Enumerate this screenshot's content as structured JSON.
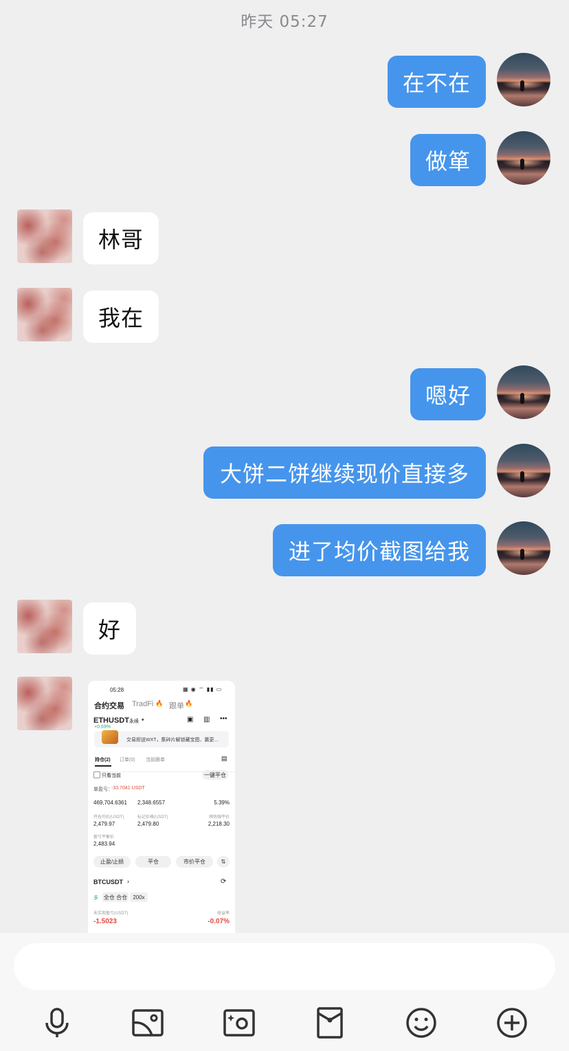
{
  "header": {
    "timestamp": "昨天 05:27"
  },
  "messages": [
    {
      "sender": "me",
      "text": "在不在"
    },
    {
      "sender": "me",
      "text": "做箪"
    },
    {
      "sender": "them",
      "text": "林哥"
    },
    {
      "sender": "them",
      "text": "我在"
    },
    {
      "sender": "me",
      "text": "嗯好"
    },
    {
      "sender": "me",
      "text": "大饼二饼继续现价直接多"
    },
    {
      "sender": "me",
      "text": "进了均价截图给我"
    },
    {
      "sender": "them",
      "text": "好"
    }
  ],
  "screenshot": {
    "status_time": "05:28",
    "tabs": [
      "合约交易",
      "TradFi",
      "跟单"
    ],
    "symbol": "ETHUSDT",
    "symbol_type": "永续",
    "change": "+0.59%",
    "banner": "交易即送WXT，集碎片解锁藏宝图、赢更...",
    "subtabs": [
      "持仓(2)",
      "订单(0)",
      "当前跟单"
    ],
    "only_current": "只看当前",
    "close_all": "一键平仓",
    "unrealized_label": "单盈亏：",
    "unrealized_value": "-33.7041 USDT",
    "row1": [
      "469,704.6361",
      "2,348.6557",
      "5.39%"
    ],
    "labels2": [
      "开仓均价(USDT)",
      "标记价格(USDT)",
      "预估强平价"
    ],
    "row2": [
      "2,479.97",
      "2,479.80",
      "2,218.30"
    ],
    "breakeven_label": "盈亏平衡价",
    "breakeven_value": "2,483.94",
    "buttons": [
      "止盈/止损",
      "平仓",
      "市价平仓"
    ],
    "symbol2": "BTCUSDT",
    "tag_long": "多",
    "tag_margin": "全仓 合仓",
    "tag_leverage": "200x",
    "pnl_label": "未实现盈亏(USDT)",
    "roi_label": "收益率",
    "pnl_value": "-1.5023",
    "roi_value": "-0.07%"
  },
  "toolbar": {
    "icons": [
      "microphone-icon",
      "image-icon",
      "camera-icon",
      "red-packet-icon",
      "emoji-icon",
      "plus-icon"
    ]
  },
  "colors": {
    "bubble_me": "#4695ec",
    "bubble_them": "#ffffff",
    "background": "#efeff0",
    "loss": "#e5473e"
  }
}
